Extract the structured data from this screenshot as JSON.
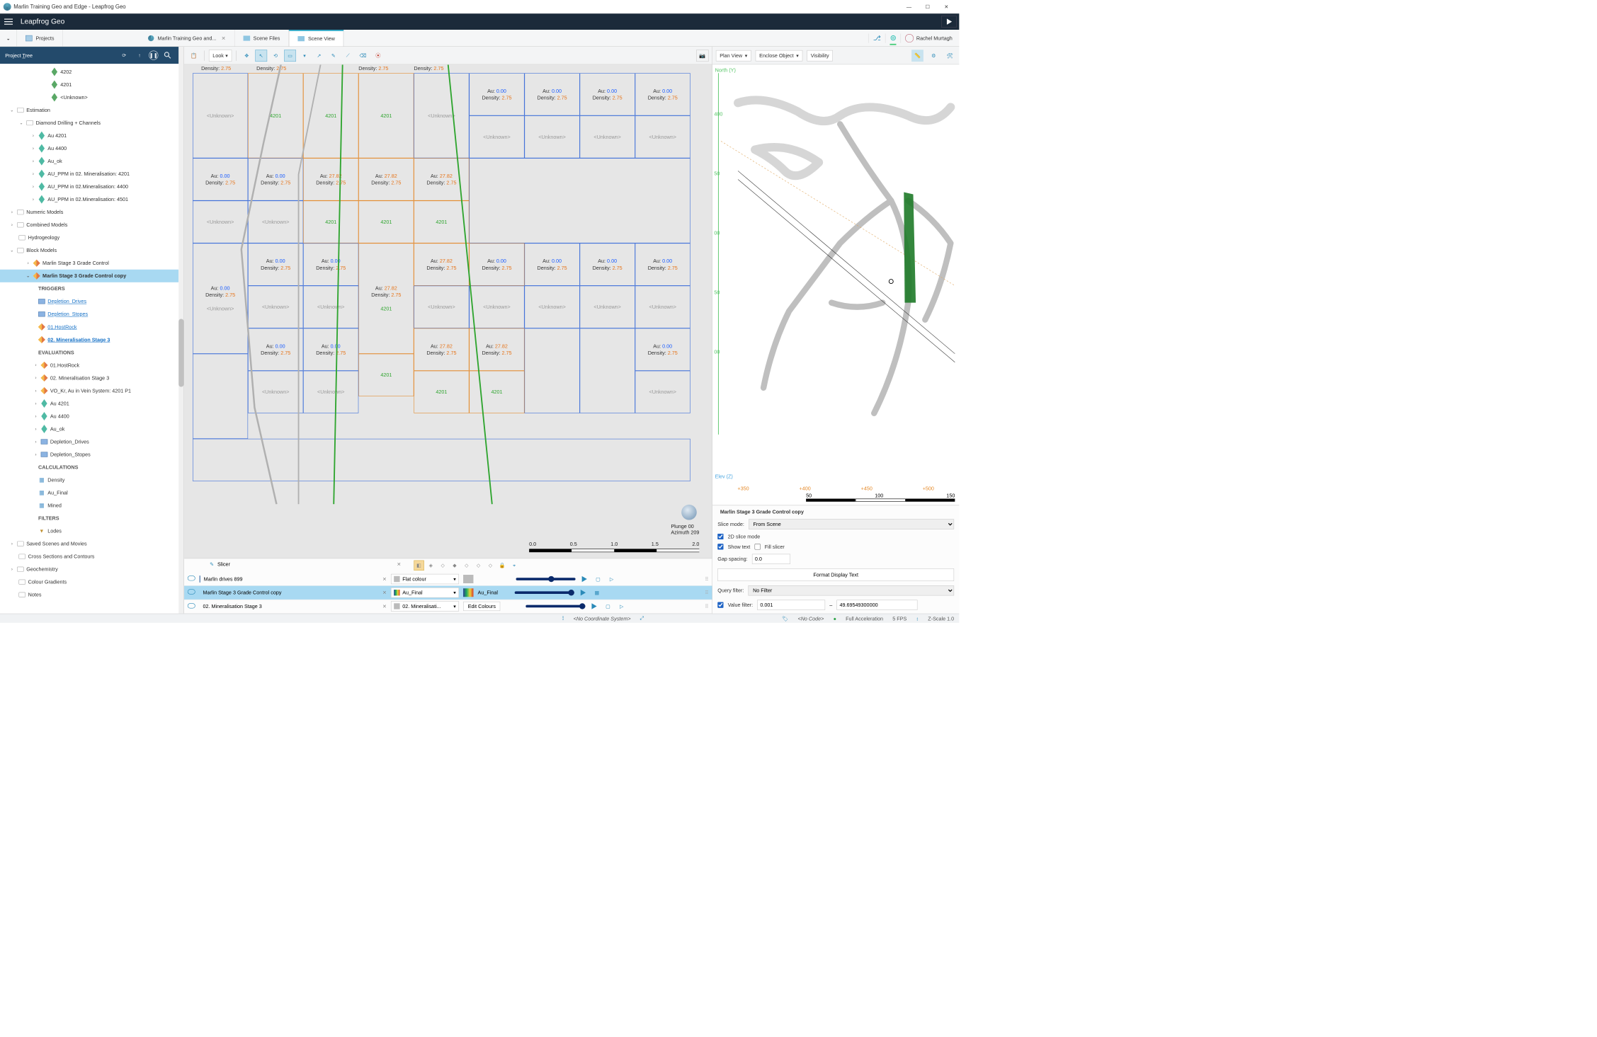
{
  "window": {
    "title": "Marlin Training Geo and Edge - Leapfrog Geo"
  },
  "app": {
    "name": "Leapfrog Geo"
  },
  "tabs": {
    "projects": "Projects",
    "doc": "Marlin Training Geo and...",
    "scene_files": "Scene Files",
    "scene_view": "Scene View"
  },
  "user": {
    "name": "Rachel Murtagh"
  },
  "sidebar": {
    "title_pre": "Project ",
    "title_u": "T",
    "title_post": "ree"
  },
  "tree": {
    "n4202": "4202",
    "n4201": "4201",
    "nUnk": "<Unknown>",
    "est": "Estimation",
    "ddc": "Diamond Drilling + Channels",
    "au4201": "Au 4201",
    "au4400": "Au 4400",
    "auok": "Au_ok",
    "auppm1": "AU_PPM in 02. Mineralisation: 4201",
    "auppm2": "AU_PPM in 02.Mineralisation: 4400",
    "auppm3": "AU_PPM in 02.Mineralisation: 4501",
    "nummod": "Numeric Models",
    "combmod": "Combined Models",
    "hydro": "Hydrogeology",
    "blockmod": "Block Models",
    "ms3gc": "Marlin Stage 3 Grade Control",
    "ms3gc_copy": "Marlin Stage 3 Grade Control copy",
    "triggers": "TRIGGERS",
    "dep_drives": "Depletion_Drives",
    "dep_stopes": "Depletion_Stopes",
    "hr01": "01.HostRock",
    "min02": "02. Mineralisation Stage 3",
    "evals": "EVALUATIONS",
    "e_hr": "01.HostRock",
    "e_min": "02. Mineralisation Stage 3",
    "vokr": "VO_Kr, Au in Vein System: 4201 P1",
    "e_au4201": "Au 4201",
    "e_au4400": "Au 4400",
    "e_auok": "Au_ok",
    "e_depd": "Depletion_Drives",
    "e_deps": "Depletion_Stopes",
    "calcs": "CALCULATIONS",
    "c_density": "Density",
    "c_aufinal": "Au_Final",
    "c_mined": "Mined",
    "filters": "FILTERS",
    "lodes": "Lodes",
    "saved": "Saved Scenes and Movies",
    "xsec": "Cross Sections and Contours",
    "geochem": "Geochemistry",
    "colgrad": "Colour Gradients",
    "notes": "Notes"
  },
  "toolbar": {
    "look": "Look"
  },
  "block_labels": {
    "au": "Au:",
    "density": "Density:",
    "unknown": "<Unknown>",
    "v0": "0.00",
    "v2782": "27.82",
    "d275": "2.75",
    "vein4201": "4201"
  },
  "scale": {
    "t0": "0.0",
    "t1": "0.5",
    "t2": "1.0",
    "t3": "1.5",
    "t4": "2.0"
  },
  "plunge": {
    "l1": "Plunge 00",
    "l2": "Azimuth 209"
  },
  "scene_list": {
    "slicer": "Slicer",
    "r1": "Marlin drives 899",
    "r2": "Marlin Stage 3 Grade Control copy",
    "r3": "02. Mineralisation Stage 3",
    "flat": "Flat colour",
    "aufinal": "Au_Final",
    "min": "02. Mineralisati...",
    "edit": "Edit Colours"
  },
  "rp": {
    "plan": "Plan View",
    "enclose": "Enclose Object",
    "vis": "Visibility",
    "north": "North (Y)",
    "elev": "Elev (Z)",
    "x350": "+350",
    "x400": "+400",
    "x450": "+450",
    "x500": "+500",
    "s50": "50",
    "s100": "100",
    "s150": "150"
  },
  "props": {
    "title": "Marlin Stage 3 Grade Control copy",
    "slice_mode_lbl": "Slice mode:",
    "slice_mode_val": "From Scene",
    "cb_2d": "2D slice mode",
    "cb_text": "Show text",
    "cb_fill": "Fill slicer",
    "gap_lbl": "Gap spacing:",
    "gap_val": "0.0",
    "fmt": "Format Display Text",
    "qf_lbl": "Query filter:",
    "qf_val": "No Filter",
    "vf_lbl": "Value filter:",
    "vf_lo": "0.001",
    "vf_hi": "49.69549300000"
  },
  "status": {
    "coord": "<No Coordinate System>",
    "nocode": "<No Code>",
    "accel": "Full Acceleration",
    "fps": "5 FPS",
    "zscale": "Z-Scale 1.0"
  }
}
